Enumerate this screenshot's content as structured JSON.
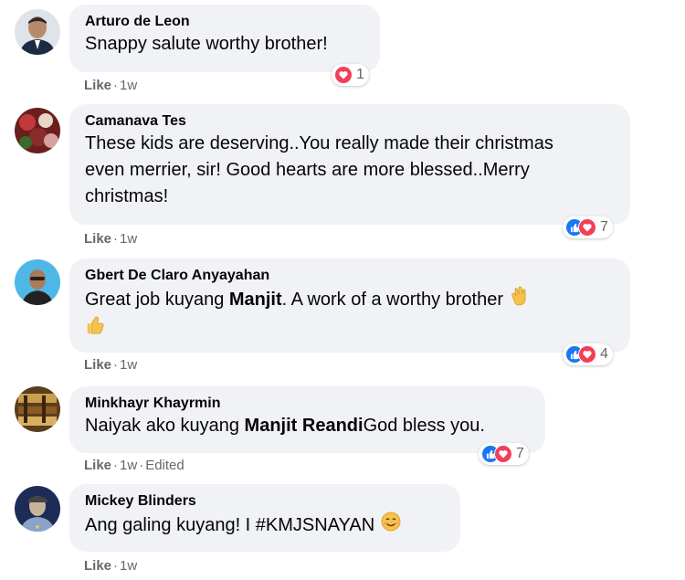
{
  "comments": [
    {
      "author": "Arturo de Leon",
      "text": "Snappy salute worthy brother!",
      "reaction_count": "1",
      "like_label": "Like",
      "time": "1w"
    },
    {
      "author": "Camanava Tes",
      "text_line1": "These kids are deserving..You really made their christmas",
      "text_line2": "even merrier, sir! Good hearts are more blessed..Merry",
      "text_line3": "christmas!",
      "reaction_count": "7",
      "like_label": "Like",
      "time": "1w"
    },
    {
      "author": "Gbert De Claro Anyayahan",
      "text_before": "Great job kuyang ",
      "mention": "Manjit",
      "text_after": ". A work of a worthy brother",
      "reaction_count": "4",
      "like_label": "Like",
      "time": "1w"
    },
    {
      "author": "Minkhayr Khayrmin",
      "text_before": "Naiyak ako kuyang ",
      "mention": "Manjit Reandi",
      "text_after": "God bless you.",
      "reaction_count": "7",
      "like_label": "Like",
      "time": "1w",
      "edited": "Edited"
    },
    {
      "author": "Mickey Blinders",
      "text": "Ang galing kuyang! I #KMJSNAYAN",
      "like_label": "Like",
      "time": "1w"
    }
  ],
  "icons": [
    "heart-icon",
    "like-icon",
    "clapping-hands-icon",
    "thumbs-up-icon",
    "smiling-face-icon"
  ],
  "colors": {
    "bubble": "#f0f2f5",
    "like_blue": "#1877f2",
    "love_red": "#f33e58",
    "meta_gray": "#65676b"
  }
}
